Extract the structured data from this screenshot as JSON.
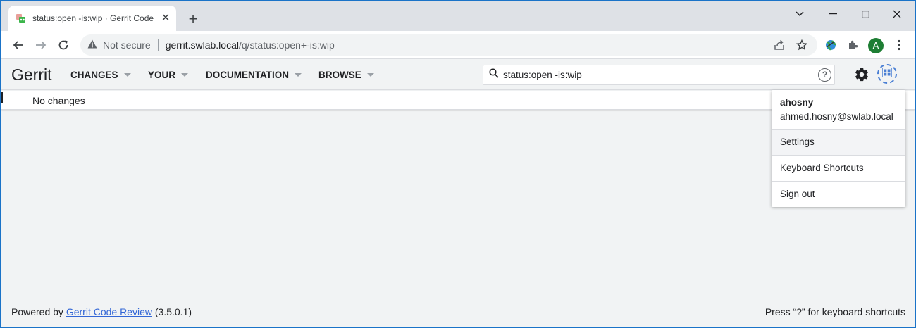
{
  "browser": {
    "tab_title": "status:open -is:wip · Gerrit Code Review",
    "not_secure_label": "Not secure",
    "url_host": "gerrit.swlab.local",
    "url_path": "/q/status:open+-is:wip",
    "profile_initial": "A"
  },
  "gerrit": {
    "logo": "Gerrit",
    "nav": [
      "CHANGES",
      "YOUR",
      "DOCUMENTATION",
      "BROWSE"
    ],
    "search_value": "status:open -is:wip",
    "help_glyph": "?"
  },
  "content": {
    "empty_text": "No changes"
  },
  "account_menu": {
    "username": "ahosny",
    "email": "ahmed.hosny@swlab.local",
    "items": [
      "Settings",
      "Keyboard Shortcuts",
      "Sign out"
    ]
  },
  "footer": {
    "powered_by": "Powered by",
    "link_text": "Gerrit Code Review",
    "version": "(3.5.0.1)",
    "shortcut_hint": "Press “?” for keyboard shortcuts"
  },
  "colors": {
    "window_border": "#1a73c8",
    "link": "#3367d6",
    "profile_avatar": "#1e7e34",
    "account_icon": "#4a7fd4"
  }
}
